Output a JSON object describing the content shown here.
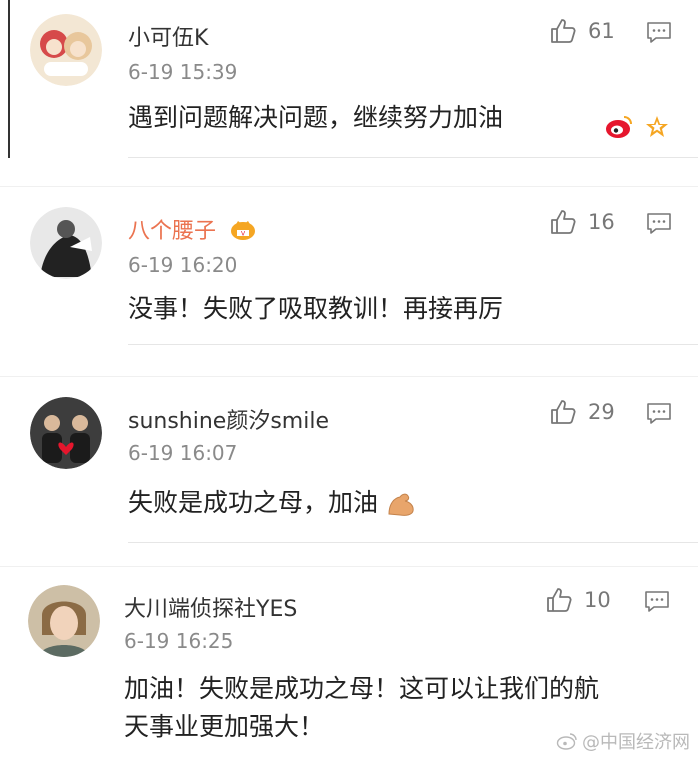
{
  "comments": [
    {
      "username": "小可伍K",
      "time": "6-19 15:39",
      "text": "遇到问题解决问题，继续努力加油",
      "likes": "61"
    },
    {
      "username": "八个腰子",
      "time": "6-19 16:20",
      "text": "没事！失败了吸取教训！再接再厉",
      "likes": "16"
    },
    {
      "username": "sunshine颜汐smile",
      "time": "6-19 16:07",
      "text": "失败是成功之母，加油",
      "likes": "29"
    },
    {
      "username": "大川端侦探社YES",
      "time": "6-19 16:25",
      "text_line1": "加油！失败是成功之母！这可以让我们的航",
      "text_line2": "天事业更加强大！",
      "likes": "10"
    }
  ],
  "watermark": "@中国经济网",
  "colors": {
    "vip_name": "#eb7350",
    "weibo_red": "#e6162d",
    "star_gold": "#f5a623"
  },
  "icons": {
    "like": "thumbs-up-icon",
    "reply": "comment-bubble-icon",
    "vip": "crown-badge-icon",
    "weibo": "weibo-logo-icon",
    "star": "star-badge-icon",
    "emoji": "flexed-biceps-emoji"
  }
}
